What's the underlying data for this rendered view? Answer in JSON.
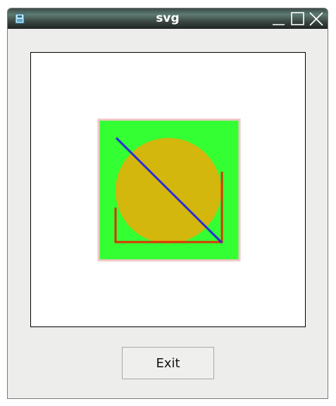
{
  "window": {
    "title": "svg",
    "controls": {
      "minimize": "minimize-icon",
      "maximize": "maximize-icon",
      "close": "close-icon"
    },
    "app_icon": "app-icon"
  },
  "canvas": {
    "background": "#ffffff",
    "shapes": {
      "square_fill": "#33ff33",
      "square_stroke": "#f2c6c6",
      "circle_fill": "#d4b70c",
      "line_stroke": "#2a2fd6",
      "polyline_stroke": "#dd3300"
    }
  },
  "exit_button": {
    "label": "Exit"
  }
}
